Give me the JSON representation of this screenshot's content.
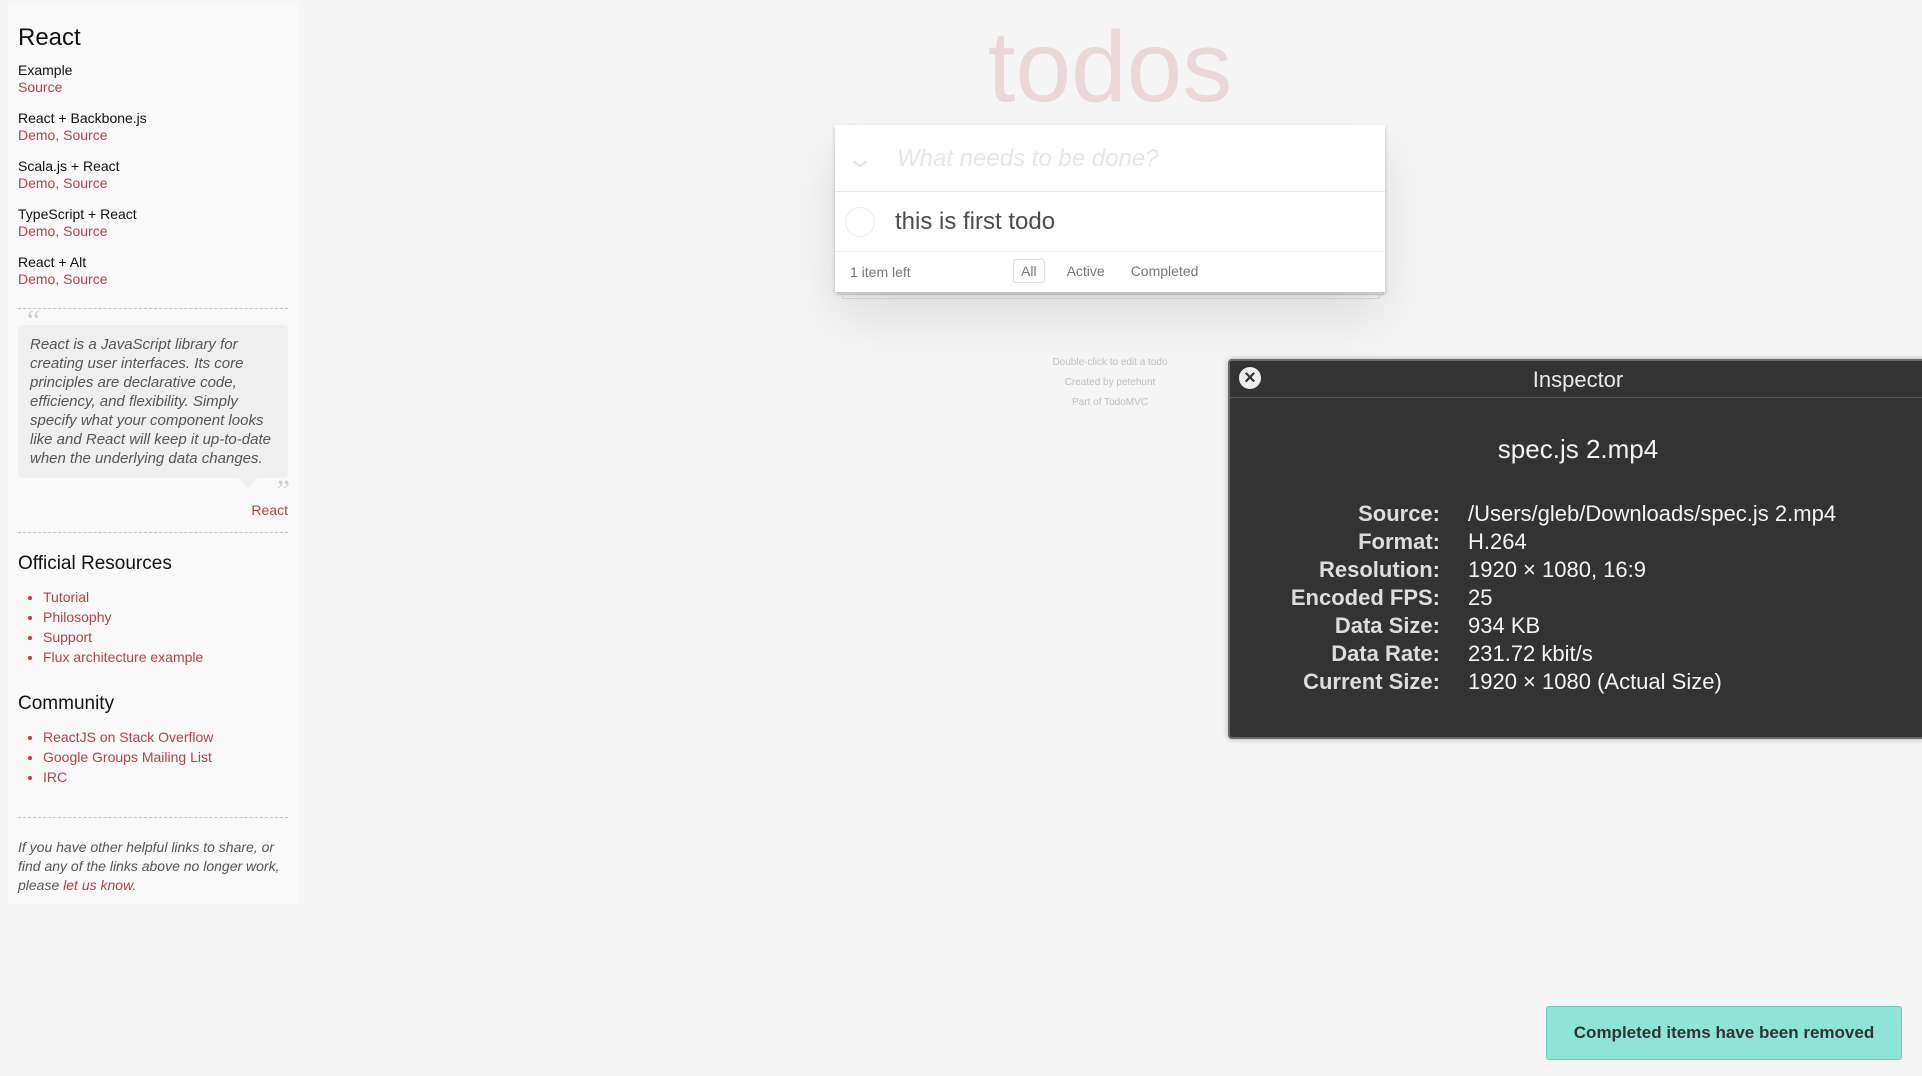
{
  "sidebar": {
    "title": "React",
    "examples": [
      {
        "name": "Example",
        "links": [
          "Source"
        ]
      },
      {
        "name": "React + Backbone.js",
        "links": [
          "Demo",
          "Source"
        ]
      },
      {
        "name": "Scala.js + React",
        "links": [
          "Demo",
          "Source"
        ]
      },
      {
        "name": "TypeScript + React",
        "links": [
          "Demo",
          "Source"
        ]
      },
      {
        "name": "React + Alt",
        "links": [
          "Demo",
          "Source"
        ]
      }
    ],
    "quote": "React is a JavaScript library for creating user interfaces. Its core principles are declarative code, efficiency, and flexibility. Simply specify what your component looks like and React will keep it up-to-date when the underlying data changes.",
    "quote_source": "React",
    "official_title": "Official Resources",
    "official_links": [
      "Tutorial",
      "Philosophy",
      "Support",
      "Flux architecture example"
    ],
    "community_title": "Community",
    "community_links": [
      "ReactJS on Stack Overflow",
      "Google Groups Mailing List",
      "IRC"
    ],
    "footnote_prefix": "If you have other helpful links to share, or find any of the links above no longer work, please ",
    "footnote_link": "let us know",
    "footnote_suffix": "."
  },
  "todo": {
    "title": "todos",
    "placeholder": "What needs to be done?",
    "items": [
      {
        "text": "this is first todo",
        "completed": false
      }
    ],
    "count_text": "1 item left",
    "filters": [
      "All",
      "Active",
      "Completed"
    ],
    "selected_filter": "All",
    "info": [
      "Double-click to edit a todo",
      "Created by petehunt",
      "Part of TodoMVC"
    ]
  },
  "inspector": {
    "title": "Inspector",
    "file": "spec.js 2.mp4",
    "rows": [
      {
        "key": "Source:",
        "value": "/Users/gleb/Downloads/spec.js 2.mp4"
      },
      {
        "key": "Format:",
        "value": "H.264"
      },
      {
        "key": "Resolution:",
        "value": "1920 × 1080, 16:9"
      },
      {
        "key": "Encoded FPS:",
        "value": "25"
      },
      {
        "key": "Data Size:",
        "value": "934 KB"
      },
      {
        "key": "Data Rate:",
        "value": "231.72 kbit/s"
      },
      {
        "key": "Current Size:",
        "value": "1920 × 1080 (Actual Size)"
      }
    ],
    "close_icon": "close-icon"
  },
  "toast": {
    "message": "Completed items have been removed"
  },
  "colors": {
    "accent": "#b83f45",
    "toast_bg": "#8fe5d5",
    "inspector_bg": "#333333"
  }
}
